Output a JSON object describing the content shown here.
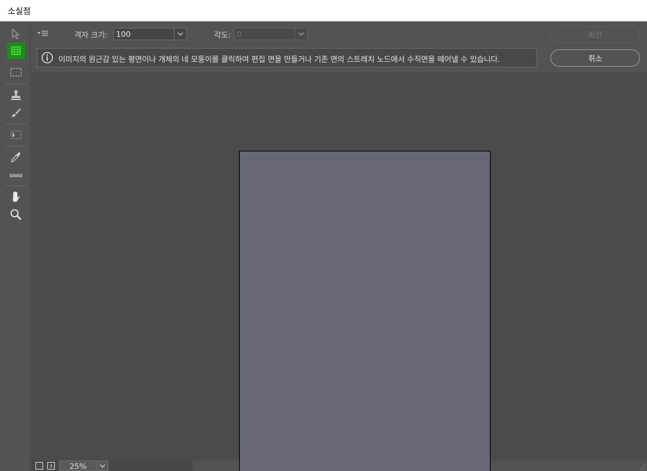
{
  "window": {
    "title": "소실점"
  },
  "toolbox": {
    "tools": [
      {
        "name": "edit-plane-tool",
        "icon": "arrow-cursor-icon",
        "active": false
      },
      {
        "name": "create-plane-tool",
        "icon": "grid-plane-icon",
        "active": true
      },
      {
        "name": "marquee-tool",
        "icon": "marquee-icon",
        "active": false
      },
      {
        "name": "stamp-tool",
        "icon": "stamp-icon",
        "active": false
      },
      {
        "name": "brush-tool",
        "icon": "brush-icon",
        "active": false
      },
      {
        "name": "transform-tool",
        "icon": "transform-icon",
        "active": false
      },
      {
        "name": "eyedropper-tool",
        "icon": "eyedropper-icon",
        "active": false
      },
      {
        "name": "measure-tool",
        "icon": "ruler-icon",
        "active": false
      },
      {
        "name": "hand-tool",
        "icon": "hand-icon",
        "active": false
      },
      {
        "name": "zoom-tool",
        "icon": "magnifier-icon",
        "active": false
      }
    ],
    "active_color": "#1d8a1b"
  },
  "options": {
    "grid_size_label": "격자 크기:",
    "grid_size_value": "100",
    "angle_label": "각도:",
    "angle_value": "0",
    "ok_label": "확인",
    "cancel_label": "취소"
  },
  "info": {
    "icon": "info-icon",
    "text": "이미지의 원근감 있는 평면이나 개체의 네 모퉁이를 클릭하여 편집 면을 만들거나 기존 면의 스트레치 노드에서 수직면을 떼어낼 수 있습니다."
  },
  "canvas": {
    "document_color": "#676874"
  },
  "status": {
    "zoom": "25%"
  }
}
